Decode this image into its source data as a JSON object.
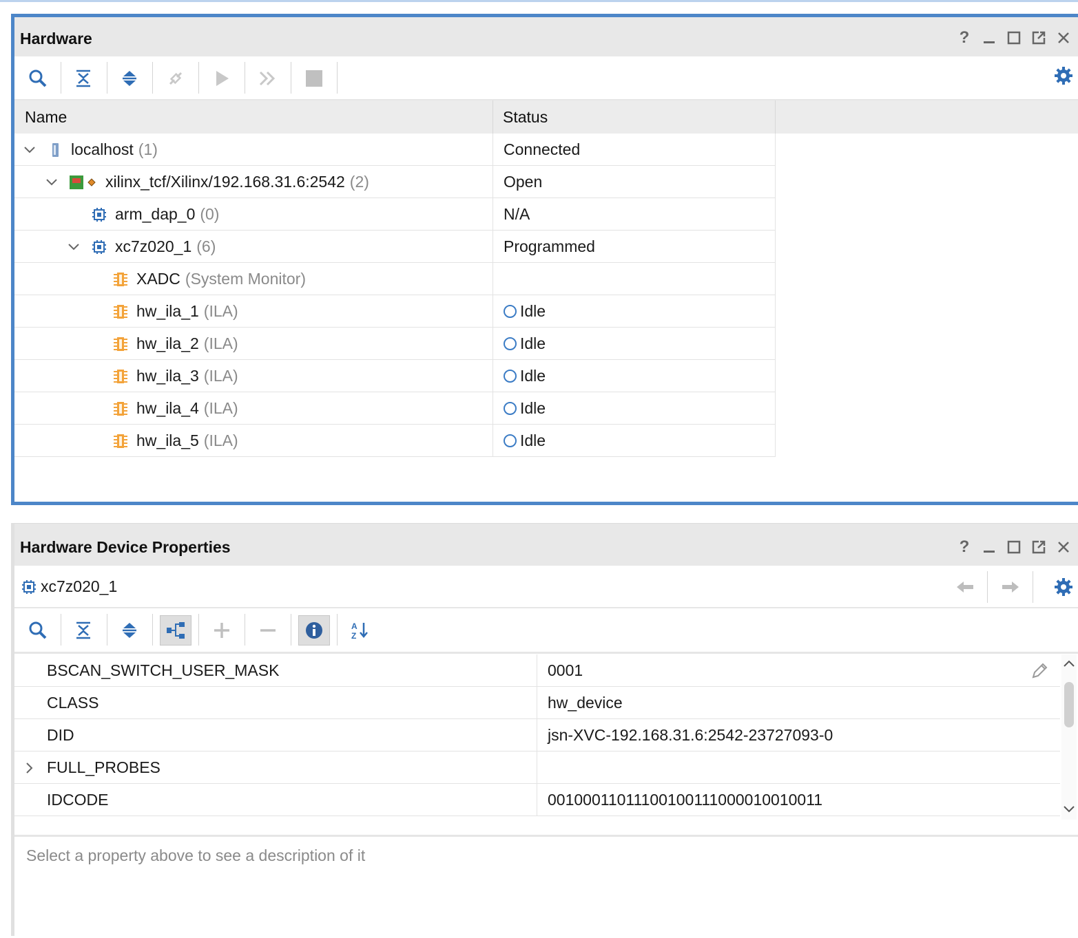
{
  "hardware": {
    "title": "Hardware",
    "columns": {
      "name": "Name",
      "status": "Status"
    },
    "rows": [
      {
        "name": "localhost",
        "count": "(1)",
        "status": "Connected",
        "icon": "server-icon"
      },
      {
        "name": "xilinx_tcf/Xilinx/192.168.31.6:2542",
        "count": "(2)",
        "status": "Open",
        "icon": "board-icon"
      },
      {
        "name": "arm_dap_0",
        "count": "(0)",
        "status": "N/A",
        "icon": "chip-icon"
      },
      {
        "name": "xc7z020_1",
        "count": "(6)",
        "status": "Programmed",
        "icon": "chip-icon"
      },
      {
        "name": "XADC",
        "count": "(System Monitor)",
        "status": "",
        "icon": "core-icon"
      },
      {
        "name": "hw_ila_1",
        "count": "(ILA)",
        "status": "Idle",
        "icon": "core-icon"
      },
      {
        "name": "hw_ila_2",
        "count": "(ILA)",
        "status": "Idle",
        "icon": "core-icon"
      },
      {
        "name": "hw_ila_3",
        "count": "(ILA)",
        "status": "Idle",
        "icon": "core-icon"
      },
      {
        "name": "hw_ila_4",
        "count": "(ILA)",
        "status": "Idle",
        "icon": "core-icon"
      },
      {
        "name": "hw_ila_5",
        "count": "(ILA)",
        "status": "Idle",
        "icon": "core-icon"
      }
    ]
  },
  "props": {
    "title": "Hardware Device Properties",
    "object": "xc7z020_1",
    "rows": [
      {
        "key": "BSCAN_SWITCH_USER_MASK",
        "value": "0001"
      },
      {
        "key": "CLASS",
        "value": "hw_device"
      },
      {
        "key": "DID",
        "value": "jsn-XVC-192.168.31.6:2542-23727093-0"
      },
      {
        "key": "FULL_PROBES",
        "value": ""
      },
      {
        "key": "IDCODE",
        "value": "00100011011100100111000010010011"
      }
    ],
    "description": "Select a property above to see a description of it"
  },
  "window_controls": {
    "help": "?",
    "minimize": "_"
  },
  "colors": {
    "accent": "#4d86c8",
    "icon_blue": "#2f6db5",
    "core_orange": "#f3a33a",
    "green": "#3c9a3c"
  }
}
